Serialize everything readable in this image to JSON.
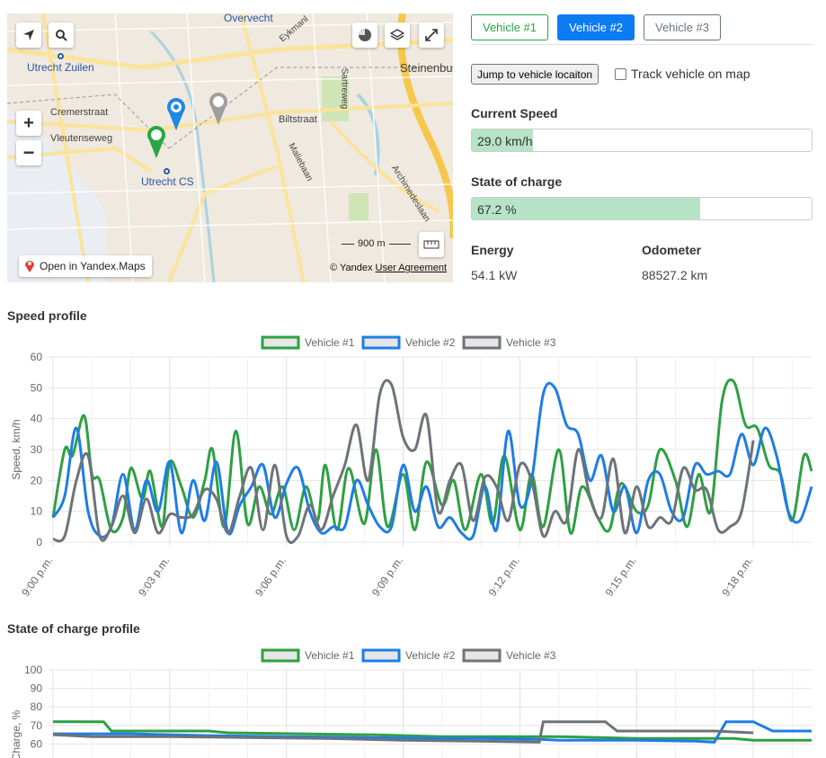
{
  "map": {
    "places": [
      {
        "name": "Overvecht",
        "kind": "district"
      },
      {
        "name": "Utrecht Zuilen",
        "kind": "station"
      },
      {
        "name": "Steinenbu",
        "kind": "district"
      },
      {
        "name": "Utrecht CS",
        "kind": "station"
      }
    ],
    "streets": [
      "Cremerstraat",
      "Vleutenseweg",
      "Biltstraat",
      "Maliebaan",
      "Archimedeslaan",
      "Sartreweg",
      "Eykmanl"
    ],
    "open_link": "Open in Yandex.Maps",
    "copyright": "© Yandex",
    "agreement": "User Agreement",
    "scale": "900 m",
    "markers": [
      {
        "vehicle": "Vehicle #1",
        "color": "#28a745"
      },
      {
        "vehicle": "Vehicle #2",
        "color": "#1e88e5"
      },
      {
        "vehicle": "Vehicle #3",
        "color": "#9e9e9e"
      }
    ],
    "controls": [
      "locate-icon",
      "search-icon",
      "traffic-icon",
      "layers-icon",
      "fullscreen-icon",
      "zoom-in-icon",
      "zoom-out-icon",
      "ruler-icon"
    ]
  },
  "tabs": [
    {
      "label": "Vehicle #1"
    },
    {
      "label": "Vehicle #2"
    },
    {
      "label": "Vehicle #3"
    }
  ],
  "jump_button": "Jump to vehicle locaiton",
  "track_label": "Track vehicle on map",
  "current_speed": {
    "label": "Current Speed",
    "value": "29.0 km/h",
    "fraction": 0.18
  },
  "soc": {
    "label": "State of charge",
    "value": "67.2 %",
    "fraction": 0.672
  },
  "energy": {
    "label": "Energy",
    "value": "54.1 kW"
  },
  "odometer": {
    "label": "Odometer",
    "value": "88527.2 km"
  },
  "colors": {
    "v1": "#2ea043",
    "v2": "#1e7de6",
    "v3": "#6e7378",
    "active": "#0d7bf2"
  },
  "speed_title": "Speed profile",
  "soc_title": "State of charge profile",
  "chart_data": [
    {
      "type": "line",
      "title": "Speed profile",
      "ylabel": "Speed, km/h",
      "ylim": [
        0,
        60
      ],
      "yticks": [
        0,
        10,
        20,
        30,
        40,
        50,
        60
      ],
      "xticks": [
        "9:00 p.m.",
        "9:03 p.m.",
        "9:06 p.m.",
        "9:09 p.m.",
        "9:12 p.m.",
        "9:15 p.m.",
        "9:18 p.m."
      ],
      "xrange_minutes": [
        0,
        19.5
      ],
      "legend": "top-center",
      "series": [
        {
          "name": "Vehicle #1",
          "x": [
            0,
            0.3,
            0.5,
            0.8,
            1,
            1.2,
            1.5,
            1.8,
            2,
            2.3,
            2.5,
            2.8,
            3,
            3.3,
            3.6,
            3.9,
            4.1,
            4.4,
            4.7,
            5,
            5.3,
            5.6,
            5.9,
            6.2,
            6.5,
            6.8,
            7,
            7.3,
            7.6,
            8,
            8.3,
            8.6,
            9,
            9.3,
            9.6,
            10,
            10.3,
            10.6,
            11,
            11.3,
            11.6,
            12,
            12.3,
            12.6,
            13,
            13.3,
            13.6,
            14,
            14.3,
            14.6,
            15,
            15.3,
            15.6,
            16,
            16.3,
            16.6,
            16.9,
            17.2,
            17.5,
            17.8,
            18.1,
            18.4,
            18.7,
            19,
            19.3,
            19.5
          ],
          "values": [
            8,
            30,
            28,
            41,
            22,
            20,
            4,
            8,
            24,
            14,
            23,
            5,
            26,
            18,
            8,
            20,
            30,
            5,
            36,
            6,
            18,
            9,
            18,
            4,
            18,
            7,
            25,
            4,
            24,
            6,
            30,
            5,
            22,
            4,
            26,
            12,
            20,
            4,
            22,
            6,
            28,
            4,
            22,
            5,
            30,
            3,
            18,
            8,
            4,
            19,
            10,
            12,
            30,
            20,
            5,
            22,
            10,
            46,
            52,
            38,
            37,
            25,
            22,
            7,
            28,
            23
          ]
        },
        {
          "name": "Vehicle #2",
          "x": [
            0,
            0.3,
            0.6,
            0.9,
            1.2,
            1.5,
            1.8,
            2.1,
            2.4,
            2.7,
            3,
            3.3,
            3.6,
            3.9,
            4.2,
            4.5,
            4.8,
            5.1,
            5.4,
            5.7,
            6,
            6.3,
            6.6,
            6.9,
            7.2,
            7.5,
            7.8,
            8.1,
            8.4,
            8.7,
            9,
            9.3,
            9.6,
            9.9,
            10.2,
            10.5,
            10.8,
            11.1,
            11.4,
            11.7,
            12,
            12.3,
            12.6,
            12.9,
            13.2,
            13.5,
            13.8,
            14.1,
            14.4,
            14.7,
            15,
            15.3,
            15.6,
            15.9,
            16.2,
            16.5,
            16.8,
            17.1,
            17.4,
            17.7,
            18,
            18.3,
            18.6,
            18.9,
            19.2,
            19.5
          ],
          "values": [
            8,
            15,
            37,
            10,
            2,
            5,
            22,
            4,
            20,
            10,
            26,
            3,
            20,
            7,
            26,
            3,
            12,
            18,
            25,
            8,
            19,
            24,
            10,
            3,
            5,
            5,
            20,
            12,
            5,
            5,
            25,
            10,
            18,
            5,
            8,
            3,
            2,
            18,
            4,
            36,
            12,
            20,
            48,
            50,
            38,
            35,
            20,
            28,
            10,
            18,
            3,
            20,
            22,
            10,
            8,
            25,
            22,
            23,
            22,
            35,
            25,
            37,
            28,
            10,
            7,
            18
          ]
        },
        {
          "name": "Vehicle #3",
          "x": [
            0,
            0.3,
            0.6,
            0.9,
            1.2,
            1.5,
            1.8,
            2.1,
            2.4,
            2.7,
            3,
            3.3,
            3.6,
            3.9,
            4.2,
            4.5,
            4.8,
            5.1,
            5.4,
            5.7,
            6,
            6.3,
            6.6,
            6.9,
            7.2,
            7.5,
            7.8,
            8.1,
            8.4,
            8.7,
            9,
            9.3,
            9.6,
            9.9,
            10.2,
            10.5,
            10.8,
            11.1,
            11.4,
            11.7,
            12,
            12.3,
            12.6,
            12.9,
            13.2,
            13.5,
            13.8,
            14.1,
            14.4,
            14.7,
            15,
            15.3,
            15.6,
            15.9,
            16.2,
            16.5,
            16.8,
            17.1,
            17.4,
            17.7,
            18
          ],
          "values": [
            1,
            2,
            20,
            28,
            2,
            5,
            15,
            3,
            14,
            3,
            9,
            8,
            9,
            17,
            14,
            3,
            15,
            24,
            4,
            25,
            2,
            2,
            12,
            4,
            15,
            25,
            38,
            20,
            48,
            51,
            34,
            30,
            41,
            10,
            20,
            25,
            7,
            21,
            18,
            7,
            25,
            20,
            2,
            10,
            7,
            30,
            15,
            8,
            27,
            3,
            18,
            5,
            8,
            7,
            24,
            17,
            17,
            4,
            5,
            10,
            33
          ]
        }
      ]
    },
    {
      "type": "line",
      "title": "State of charge profile",
      "ylabel": "Charge, %",
      "ylim": [
        60,
        100
      ],
      "yticks": [
        60,
        70,
        80,
        90,
        100
      ],
      "legend": "top-center",
      "series": [
        {
          "name": "Vehicle #1",
          "x": [
            0,
            1.3,
            1.5,
            4,
            4.5,
            8,
            8.2,
            10,
            10.5,
            13,
            15,
            16,
            17.5,
            18,
            19.5
          ],
          "values": [
            72,
            72,
            67,
            67,
            66,
            65,
            65,
            64,
            64,
            64,
            63,
            63,
            63,
            62,
            62
          ]
        },
        {
          "name": "Vehicle #2",
          "x": [
            0,
            2,
            4,
            6,
            8,
            10,
            11,
            12.5,
            13,
            15,
            16.5,
            17,
            17.3,
            18,
            18.5,
            19.5
          ],
          "values": [
            65.5,
            65.5,
            64.5,
            64,
            63.5,
            63,
            63,
            62.5,
            62,
            62,
            61.5,
            61,
            72,
            72,
            67,
            67
          ]
        },
        {
          "name": "Vehicle #3",
          "x": [
            0,
            1,
            3,
            5,
            7,
            9,
            11,
            12.5,
            12.6,
            14.2,
            14.5,
            17,
            18
          ],
          "values": [
            65,
            64,
            64,
            63.5,
            63,
            62,
            61.5,
            61,
            72,
            72,
            67,
            67,
            66
          ]
        }
      ]
    }
  ]
}
